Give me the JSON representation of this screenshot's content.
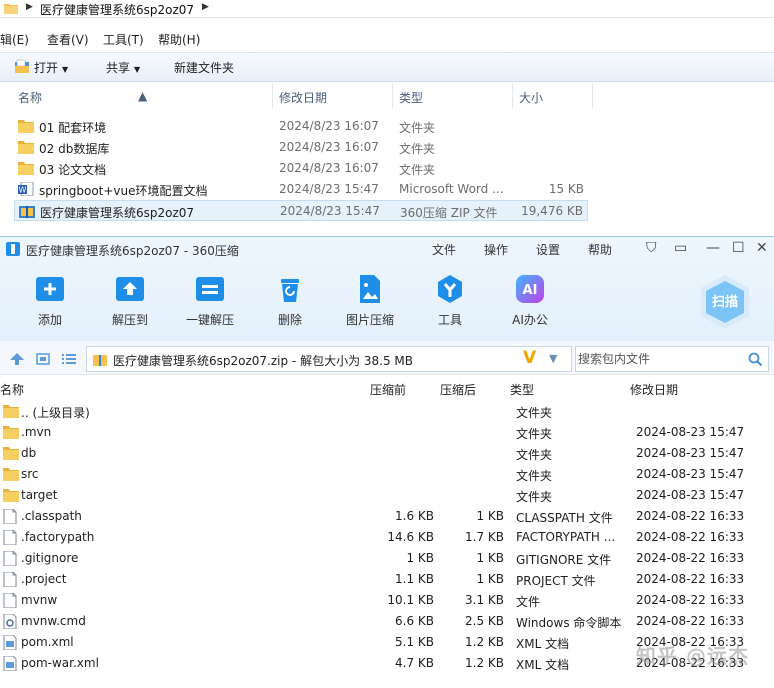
{
  "explorer": {
    "breadcrumb": "医疗健康管理系统6sp2oz07",
    "menu": [
      "辑(E)",
      "查看(V)",
      "工具(T)",
      "帮助(H)"
    ],
    "toolbar": {
      "open": "打开",
      "share": "共享",
      "new_folder": "新建文件夹"
    },
    "columns": {
      "name": "名称",
      "date": "修改日期",
      "type": "类型",
      "size": "大小"
    },
    "rows": [
      {
        "name": "01 配套环境",
        "date": "2024/8/23 16:07",
        "type": "文件夹",
        "size": "",
        "icon": "folder-icon"
      },
      {
        "name": "02 db数据库",
        "date": "2024/8/23 16:07",
        "type": "文件夹",
        "size": "",
        "icon": "folder-icon"
      },
      {
        "name": "03 论文文档",
        "date": "2024/8/23 16:07",
        "type": "文件夹",
        "size": "",
        "icon": "folder-icon"
      },
      {
        "name": "springboot+vue环境配置文档",
        "date": "2024/8/23 15:47",
        "type": "Microsoft Word ...",
        "size": "15 KB",
        "icon": "word-doc-icon"
      },
      {
        "name": "医疗健康管理系统6sp2oz07",
        "date": "2024/8/23 15:47",
        "type": "360压缩 ZIP 文件",
        "size": "19,476 KB",
        "icon": "zip-icon"
      }
    ]
  },
  "zip": {
    "title": "医疗健康管理系统6sp2oz07 - 360压缩",
    "menu": [
      "文件",
      "操作",
      "设置",
      "帮助"
    ],
    "tools": [
      {
        "label": "添加",
        "icon": "add-icon"
      },
      {
        "label": "解压到",
        "icon": "extract-to-icon"
      },
      {
        "label": "一键解压",
        "icon": "one-click-extract-icon"
      },
      {
        "label": "删除",
        "icon": "delete-icon"
      },
      {
        "label": "图片压缩",
        "icon": "image-compress-icon"
      },
      {
        "label": "工具",
        "icon": "tools-icon"
      },
      {
        "label": "AI办公",
        "icon": "ai-office-icon"
      }
    ],
    "scan_label": "扫描",
    "path": "医疗健康管理系统6sp2oz07.zip - 解包大小为 38.5 MB",
    "search_placeholder": "搜索包内文件",
    "columns": {
      "name": "名称",
      "compressed_before": "压缩前",
      "compressed_after": "压缩后",
      "type": "类型",
      "date": "修改日期"
    },
    "rows": [
      {
        "name": ".. (上级目录)",
        "before": "",
        "after": "",
        "type": "文件夹",
        "date": "",
        "icon": "folder-icon"
      },
      {
        "name": ".mvn",
        "before": "",
        "after": "",
        "type": "文件夹",
        "date": "2024-08-23 15:47",
        "icon": "folder-icon"
      },
      {
        "name": "db",
        "before": "",
        "after": "",
        "type": "文件夹",
        "date": "2024-08-23 15:47",
        "icon": "folder-icon"
      },
      {
        "name": "src",
        "before": "",
        "after": "",
        "type": "文件夹",
        "date": "2024-08-23 15:47",
        "icon": "folder-icon"
      },
      {
        "name": "target",
        "before": "",
        "after": "",
        "type": "文件夹",
        "date": "2024-08-23 15:47",
        "icon": "folder-icon"
      },
      {
        "name": ".classpath",
        "before": "1.6 KB",
        "after": "1 KB",
        "type": "CLASSPATH 文件",
        "date": "2024-08-22 16:33",
        "icon": "file-icon"
      },
      {
        "name": ".factorypath",
        "before": "14.6 KB",
        "after": "1.7 KB",
        "type": "FACTORYPATH ...",
        "date": "2024-08-22 16:33",
        "icon": "file-icon"
      },
      {
        "name": ".gitignore",
        "before": "1 KB",
        "after": "1 KB",
        "type": "GITIGNORE 文件",
        "date": "2024-08-22 16:33",
        "icon": "file-icon"
      },
      {
        "name": ".project",
        "before": "1.1 KB",
        "after": "1 KB",
        "type": "PROJECT 文件",
        "date": "2024-08-22 16:33",
        "icon": "file-icon"
      },
      {
        "name": "mvnw",
        "before": "10.1 KB",
        "after": "3.1 KB",
        "type": "文件",
        "date": "2024-08-22 16:33",
        "icon": "file-icon"
      },
      {
        "name": "mvnw.cmd",
        "before": "6.6 KB",
        "after": "2.5 KB",
        "type": "Windows 命令脚本",
        "date": "2024-08-22 16:33",
        "icon": "cmd-script-icon"
      },
      {
        "name": "pom.xml",
        "before": "5.1 KB",
        "after": "1.2 KB",
        "type": "XML 文档",
        "date": "2024-08-22 16:33",
        "icon": "xml-file-icon"
      },
      {
        "name": "pom-war.xml",
        "before": "4.7 KB",
        "after": "1.2 KB",
        "type": "XML 文档",
        "date": "2024-08-22 16:33",
        "icon": "xml-file-icon"
      }
    ]
  },
  "watermark": "知乎 @远杰",
  "colors": {
    "accent": "#1f8ee8",
    "folder": "#f2c14e",
    "selection": "#e5f1fb"
  }
}
